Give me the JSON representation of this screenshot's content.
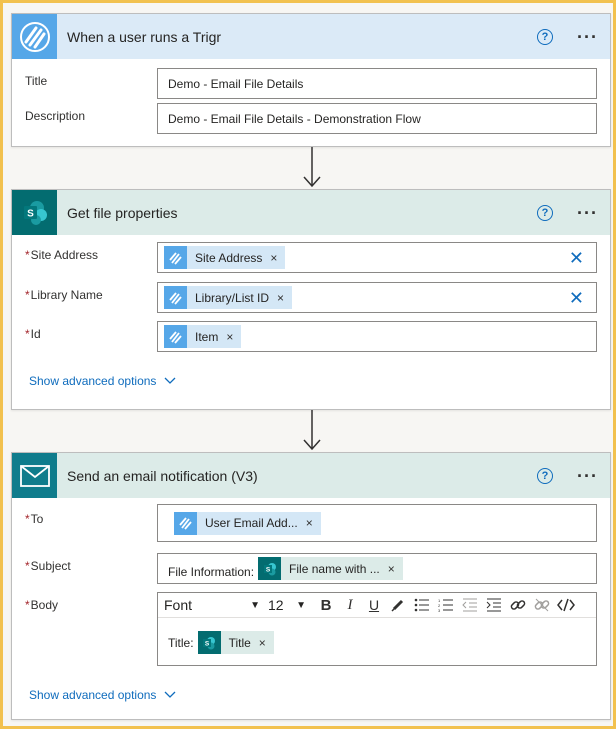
{
  "trigger": {
    "title": "When a user runs a Trigr",
    "color": "#56a7e8",
    "header_bg": "#dbeaf7",
    "fields": {
      "title_label": "Title",
      "title_value": "Demo - Email File Details",
      "description_label": "Description",
      "description_value": "Demo - Email File Details - Demonstration Flow"
    }
  },
  "get_file": {
    "title": "Get file properties",
    "color": "#036c70",
    "header_bg": "#dcebe8",
    "fields": {
      "site_label": "Site Address",
      "site_token": "Site Address",
      "library_label": "Library Name",
      "library_token": "Library/List ID",
      "id_label": "Id",
      "id_token": "Item"
    },
    "advanced": "Show advanced options"
  },
  "email": {
    "title": "Send an email notification (V3)",
    "color": "#0f7c8c",
    "header_bg": "#dcebe8",
    "fields": {
      "to_label": "To",
      "to_token": "User Email Add...",
      "subject_label": "Subject",
      "subject_prefix": "File Information:",
      "subject_token": "File name with ...",
      "body_label": "Body",
      "toolbar": {
        "font": "Font",
        "size": "12"
      },
      "body_prefix": "Title:",
      "body_token": "Title"
    },
    "advanced": "Show advanced options"
  },
  "common": {
    "required_mark": "*",
    "help": "?",
    "more": "···",
    "token_remove": "×",
    "clear": "✕"
  }
}
